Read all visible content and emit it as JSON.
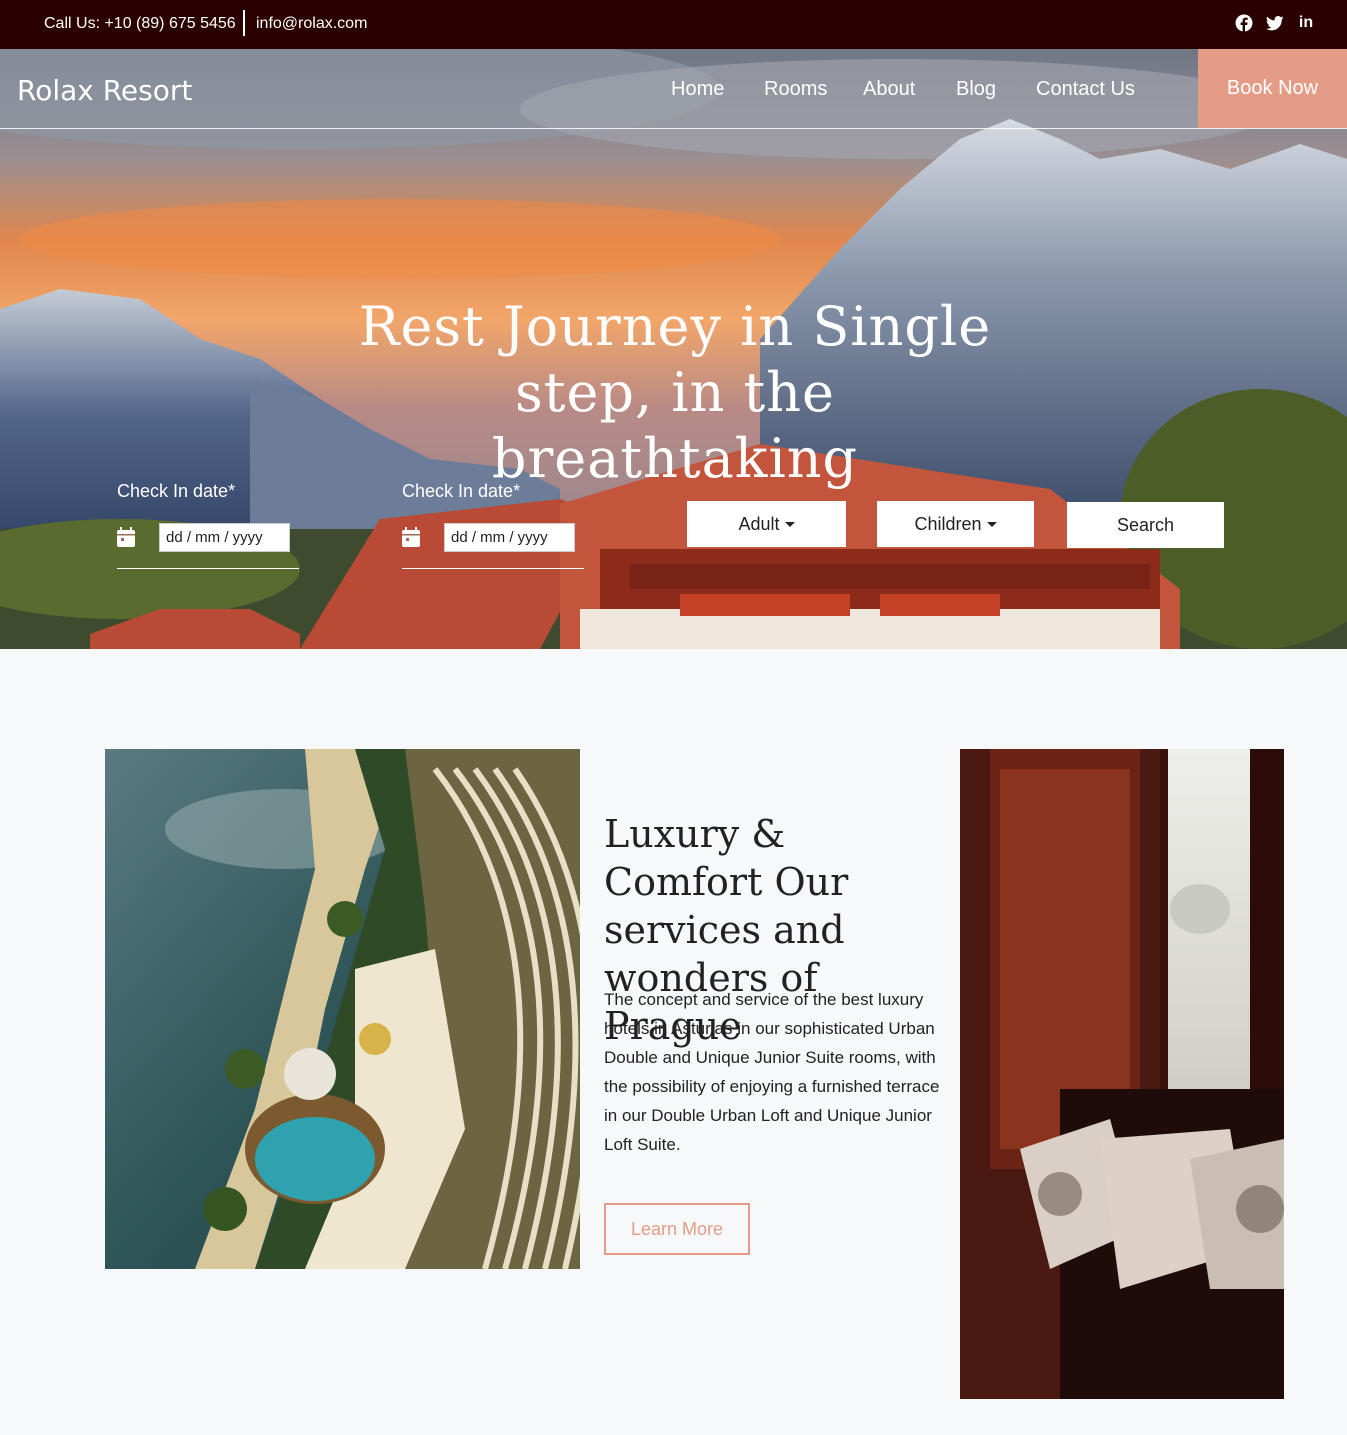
{
  "topbar": {
    "phone": "Call Us: +10 (89) 675 5456",
    "email": "info@rolax.com",
    "social": [
      "facebook-icon",
      "twitter-icon",
      "linkedin-icon"
    ]
  },
  "nav": {
    "brand": "Rolax Resort",
    "items": [
      {
        "label": "Home"
      },
      {
        "label": "Rooms"
      },
      {
        "label": "About"
      },
      {
        "label": "Blog"
      },
      {
        "label": "Contact Us"
      }
    ],
    "book": "Book Now"
  },
  "hero": {
    "title": "Rest Journey in Single step, in the breathtaking",
    "checkin1": {
      "label": "Check In date*",
      "placeholder": "dd / mm / yyyy"
    },
    "checkin2": {
      "label": "Check In date*",
      "placeholder": "dd / mm / yyyy"
    },
    "adult": "Adult",
    "children": "Children",
    "search": "Search"
  },
  "about": {
    "title": "Luxury & Comfort Our services and wonders of Prague",
    "text": "The concept and service of the best luxury hotels in Asturias in our sophisticated Urban Double and Unique Junior Suite rooms, with the possibility of enjoying a furnished terrace in our Double Urban Loft and Unique Junior Loft Suite.",
    "button": "Learn More"
  },
  "colors": {
    "topbar": "#2b0000",
    "accent": "#e49c86",
    "background": "#f7f8fa"
  }
}
